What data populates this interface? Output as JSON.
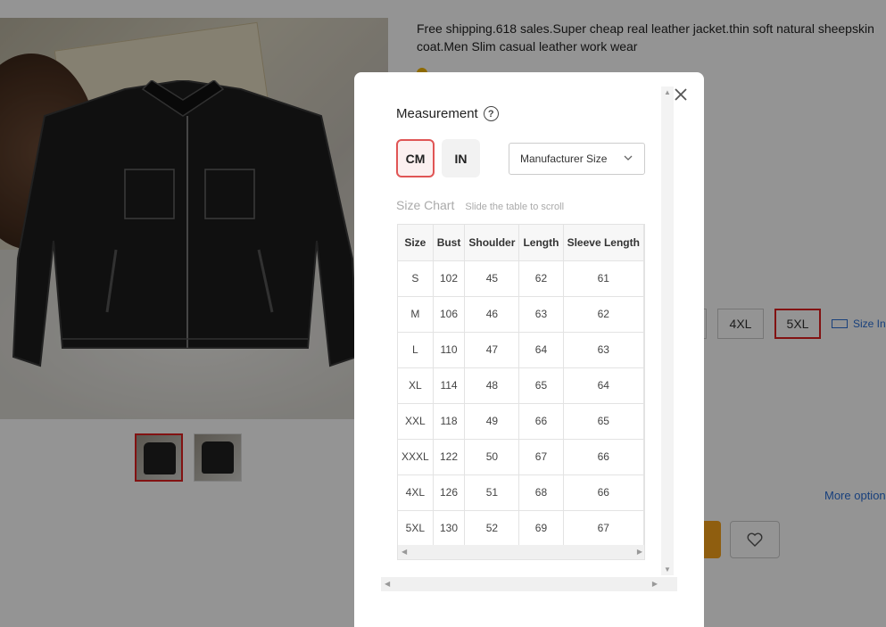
{
  "product": {
    "title": "Free shipping.618 sales.Super cheap real leather jacket.thin soft natural sheepskin coat.Men Slim casual leather work wear"
  },
  "sizes": {
    "visible": [
      "4XL",
      "5XL"
    ],
    "selected": "5XL",
    "info_label": "Size In"
  },
  "more_options": "More option",
  "modal": {
    "title": "Measurement",
    "units": [
      "CM",
      "IN"
    ],
    "active_unit": "CM",
    "size_select": "Manufacturer Size",
    "chart_label": "Size Chart",
    "scroll_hint": "Slide the table to scroll",
    "table": {
      "headers": [
        "Size",
        "Bust",
        "Shoulder",
        "Length",
        "Sleeve Length"
      ],
      "rows": [
        [
          "S",
          "102",
          "45",
          "62",
          "61"
        ],
        [
          "M",
          "106",
          "46",
          "63",
          "62"
        ],
        [
          "L",
          "110",
          "47",
          "64",
          "63"
        ],
        [
          "XL",
          "114",
          "48",
          "65",
          "64"
        ],
        [
          "XXL",
          "118",
          "49",
          "66",
          "65"
        ],
        [
          "XXXL",
          "122",
          "50",
          "67",
          "66"
        ],
        [
          "4XL",
          "126",
          "51",
          "68",
          "66"
        ],
        [
          "5XL",
          "130",
          "52",
          "69",
          "67"
        ]
      ]
    }
  },
  "colors": {
    "accent_red": "#e02020",
    "buy_orange": "#f7a21b",
    "link_blue": "#2a6fd6"
  }
}
